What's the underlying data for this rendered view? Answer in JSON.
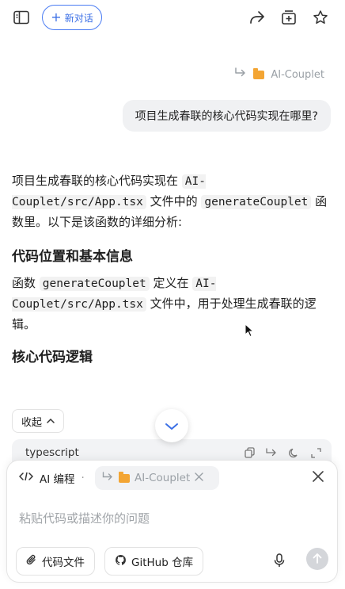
{
  "header": {
    "new_chat_label": "新对话",
    "icons": [
      "sidebar-toggle-icon",
      "share-icon",
      "add-to-collection-icon",
      "star-icon"
    ]
  },
  "user_message": {
    "reference_label": "AI-Couplet",
    "text": "项目生成春联的核心代码实现在哪里?"
  },
  "answer": {
    "intro_1": "项目生成春联的核心代码实现在 ",
    "intro_path": "AI-Couplet/src/App.tsx",
    "intro_2": " 文件中的 ",
    "intro_func": "generateCouplet",
    "intro_3": " 函数里。以下是该函数的详细分析:",
    "section1_title": "代码位置和基本信息",
    "s1_1": "函数 ",
    "s1_func": "generateCouplet",
    "s1_2": " 定义在 ",
    "s1_path": "AI-Couplet/src/App.tsx",
    "s1_3": " 文件中，用于处理生成春联的逻辑。",
    "section2_title": "核心代码逻辑",
    "collapse_label": "收起",
    "code_language": "typescript"
  },
  "composer": {
    "mode_label": "AI 编程",
    "context_chip": "AI-Couplet",
    "placeholder": "粘贴代码或描述你的问题",
    "code_file_button": "代码文件",
    "github_button": "GitHub 仓库"
  },
  "colors": {
    "accent": "#3b6fe6",
    "folder": "#f3a533",
    "bubble_bg": "#f0f1f3",
    "code_bg": "#f2f2f2"
  }
}
